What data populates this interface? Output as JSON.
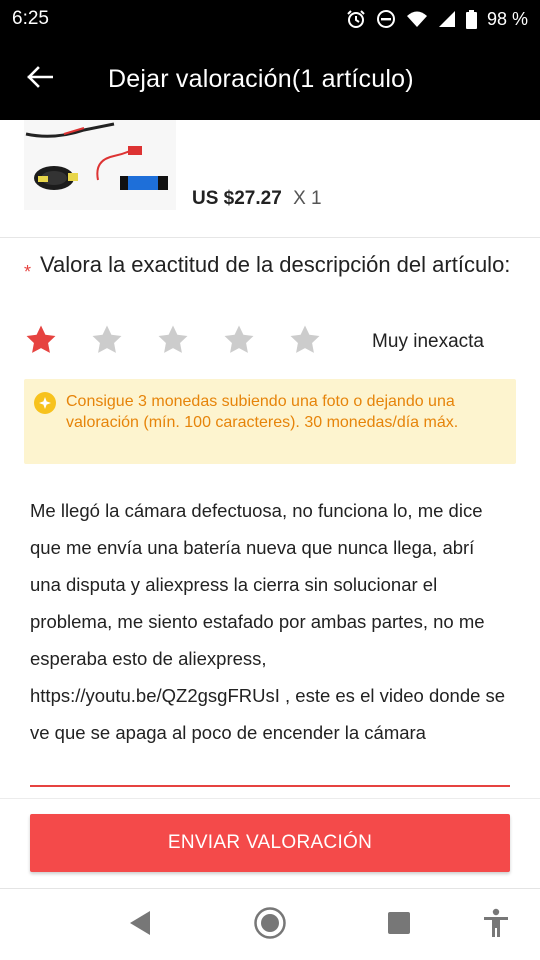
{
  "status_bar": {
    "time": "6:25",
    "battery": "98 %"
  },
  "app_bar": {
    "title": "Dejar valoración(1 artículo)"
  },
  "product": {
    "price": "US $27.27",
    "quantity": "X 1"
  },
  "question": {
    "required_mark": "*",
    "text": "Valora la exactitud de la descripción del artículo:"
  },
  "rating": {
    "value": 1,
    "max": 5,
    "label": "Muy inexacta",
    "active_color": "#e64340",
    "inactive_color": "#cccccc"
  },
  "notice": {
    "text": "Consigue 3 monedas subiendo una foto o dejando una valoración (mín. 100 caracteres). 30 monedas/día máx."
  },
  "review": {
    "text": "Me llegó la cámara defectuosa, no funciona lo, me dice que me envía una batería nueva que nunca llega, abrí una disputa y aliexpress la cierra sin solucionar el problema, me siento estafado por ambas partes, no me esperaba esto de aliexpress, https://youtu.be/QZ2gsgFRUsI  , este es el video donde se ve que se apaga al poco de encender la cámara"
  },
  "submit": {
    "label": "ENVIAR VALORACIÓN"
  },
  "colors": {
    "accent": "#f44a4a",
    "notice_bg": "#fdf4cf",
    "notice_text": "#e6840a"
  },
  "icons": {
    "back": "arrow-left-icon",
    "alarm": "alarm-icon",
    "dnd": "do-not-disturb-icon",
    "wifi": "wifi-icon",
    "signal": "signal-icon",
    "battery": "battery-icon",
    "coin": "coin-icon",
    "nav_back": "triangle-back-icon",
    "nav_home": "circle-home-icon",
    "nav_recents": "square-recents-icon",
    "accessibility": "accessibility-icon"
  }
}
